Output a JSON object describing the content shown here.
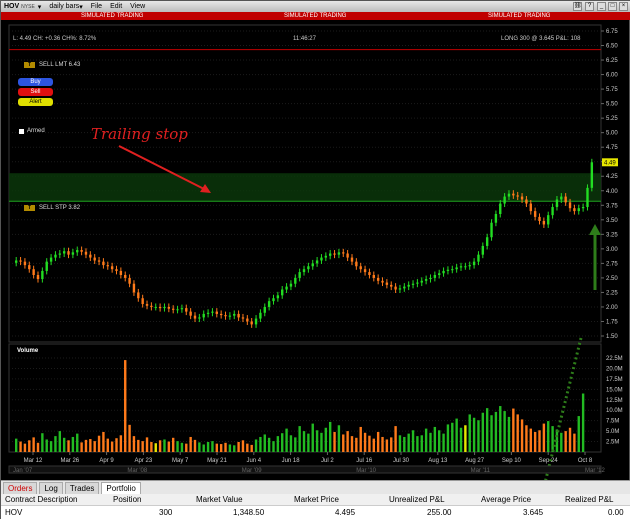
{
  "titlebar": {
    "symbol": "HOV",
    "exchange": "NYSE",
    "period": "daily bars",
    "menu": [
      "File",
      "Edit",
      "View"
    ]
  },
  "simulated": {
    "label": "SIMULATED TRADING"
  },
  "info": {
    "quote": "L: 4.49 CH: +0.36 CH%: 8.72%",
    "time": "11:46:27",
    "position": "LONG 300 @ 3.645 P&L: 108"
  },
  "buttons": {
    "buy": "Buy",
    "sell": "Sell",
    "alert": "Alert",
    "armed": "Armed"
  },
  "orders": {
    "sell_lmt": "SELL LMT 6.43",
    "sell_stp": "SELL STP 3.82",
    "last_badge": "4.49"
  },
  "annotation": {
    "text": "Trailing stop"
  },
  "volume_label": "Volume",
  "price_axis": [
    "6.75",
    "6.50",
    "6.25",
    "6.00",
    "5.75",
    "5.50",
    "5.25",
    "5.00",
    "4.75",
    "4.50",
    "4.25",
    "4.00",
    "3.75",
    "3.50",
    "3.25",
    "3.00",
    "2.75",
    "2.50",
    "2.25",
    "2.00",
    "1.75",
    "1.50"
  ],
  "volume_axis": [
    "22.5M",
    "20.0M",
    "17.5M",
    "15.0M",
    "12.5M",
    "10.0M",
    "7.5M",
    "5.0M",
    "2.5M"
  ],
  "date_axis": [
    "Mar 12",
    "Mar 26",
    "Apr 9",
    "Apr 23",
    "May 7",
    "May 21",
    "Jun 4",
    "Jun 18",
    "Jul 2",
    "Jul 16",
    "Jul 30",
    "Aug 13",
    "Aug 27",
    "Sep 10",
    "Sep 24",
    "Oct 8"
  ],
  "year_axis": [
    "Jan '07",
    "Mar '08",
    "Mar '09",
    "Mar '10",
    "Mar '11",
    "Mar '12"
  ],
  "tabs": [
    "Orders",
    "Log",
    "Trades",
    "Portfolio"
  ],
  "portfolio": {
    "headers": [
      "Contract Description",
      "Position",
      "Market Value",
      "Market Price",
      "Unrealized P&L",
      "Average Price",
      "Realized P&L"
    ],
    "row": [
      "HOV",
      "300",
      "1,348.50",
      "4.495",
      "255.00",
      "3.645",
      "0.00"
    ]
  },
  "colors": {
    "up": "#22dd22",
    "down": "#ff7a1a",
    "volume_up": "#22bb22",
    "volume_down": "#ff7a1a",
    "volume_flat": "#e8e800",
    "stop_zone": "#0b3a0b",
    "limit_line": "#c00000",
    "annotation": "#e02020",
    "arrow_green": "#2e7d1a"
  },
  "chart_data": {
    "type": "candlestick",
    "price_range": [
      1.5,
      6.75
    ],
    "volume_range_millions": [
      0,
      22.5
    ],
    "close": [
      2.8,
      2.78,
      2.72,
      2.65,
      2.55,
      2.48,
      2.62,
      2.78,
      2.85,
      2.9,
      2.92,
      2.96,
      2.9,
      2.94,
      2.98,
      2.95,
      2.9,
      2.85,
      2.8,
      2.78,
      2.72,
      2.7,
      2.65,
      2.62,
      2.55,
      2.5,
      2.4,
      2.25,
      2.15,
      2.05,
      2.02,
      2.0,
      2.0,
      1.98,
      2.0,
      1.97,
      1.95,
      1.96,
      1.98,
      1.92,
      1.85,
      1.8,
      1.82,
      1.88,
      1.9,
      1.92,
      1.88,
      1.86,
      1.84,
      1.85,
      1.88,
      1.82,
      1.8,
      1.75,
      1.7,
      1.8,
      1.9,
      2.0,
      2.1,
      2.15,
      2.2,
      2.3,
      2.35,
      2.4,
      2.5,
      2.6,
      2.65,
      2.7,
      2.75,
      2.8,
      2.85,
      2.88,
      2.92,
      2.9,
      2.94,
      2.92,
      2.85,
      2.78,
      2.7,
      2.65,
      2.6,
      2.55,
      2.5,
      2.45,
      2.42,
      2.38,
      2.35,
      2.3,
      2.32,
      2.35,
      2.38,
      2.4,
      2.42,
      2.45,
      2.48,
      2.5,
      2.55,
      2.58,
      2.62,
      2.64,
      2.65,
      2.68,
      2.7,
      2.7,
      2.72,
      2.78,
      2.9,
      3.05,
      3.2,
      3.45,
      3.6,
      3.78,
      3.9,
      3.95,
      3.92,
      3.9,
      3.85,
      3.78,
      3.65,
      3.55,
      3.48,
      3.42,
      3.58,
      3.72,
      3.85,
      3.9,
      3.8,
      3.7,
      3.65,
      3.7,
      3.72,
      4.05,
      4.49
    ],
    "volume_millions": [
      3.2,
      2.5,
      2.0,
      2.8,
      3.5,
      2.2,
      4.5,
      3.0,
      2.6,
      3.8,
      5.0,
      3.4,
      2.8,
      3.6,
      4.4,
      2.3,
      2.9,
      3.1,
      2.6,
      3.9,
      4.8,
      3.2,
      2.5,
      3.3,
      4.0,
      22.0,
      6.5,
      3.8,
      2.9,
      2.6,
      3.5,
      2.4,
      2.1,
      2.8,
      3.0,
      2.5,
      3.4,
      2.6,
      2.2,
      2.0,
      3.6,
      2.9,
      2.3,
      1.8,
      2.4,
      2.6,
      2.0,
      1.9,
      2.2,
      1.8,
      1.6,
      2.4,
      2.8,
      2.0,
      1.7,
      3.0,
      3.6,
      4.2,
      3.4,
      2.6,
      3.8,
      4.5,
      5.6,
      4.0,
      3.5,
      6.2,
      5.0,
      4.4,
      6.8,
      5.2,
      4.6,
      5.8,
      7.2,
      4.8,
      6.4,
      4.2,
      5.0,
      3.8,
      3.4,
      6.0,
      4.6,
      3.9,
      3.2,
      4.8,
      3.6,
      3.0,
      3.5,
      6.2,
      4.0,
      3.6,
      4.4,
      5.2,
      3.8,
      4.0,
      5.6,
      4.6,
      6.0,
      5.2,
      4.4,
      6.6,
      7.0,
      8.0,
      5.8,
      6.4,
      9.0,
      8.2,
      7.6,
      9.4,
      10.5,
      8.8,
      9.6,
      11.0,
      9.8,
      8.4,
      10.4,
      9.0,
      7.8,
      6.4,
      5.6,
      4.8,
      5.2,
      6.8,
      7.4,
      6.2,
      5.4,
      4.6,
      5.0,
      5.8,
      4.4,
      8.6,
      14.0
    ],
    "stop_level": 3.82,
    "limit_level": 6.43,
    "last_price": 4.49
  }
}
